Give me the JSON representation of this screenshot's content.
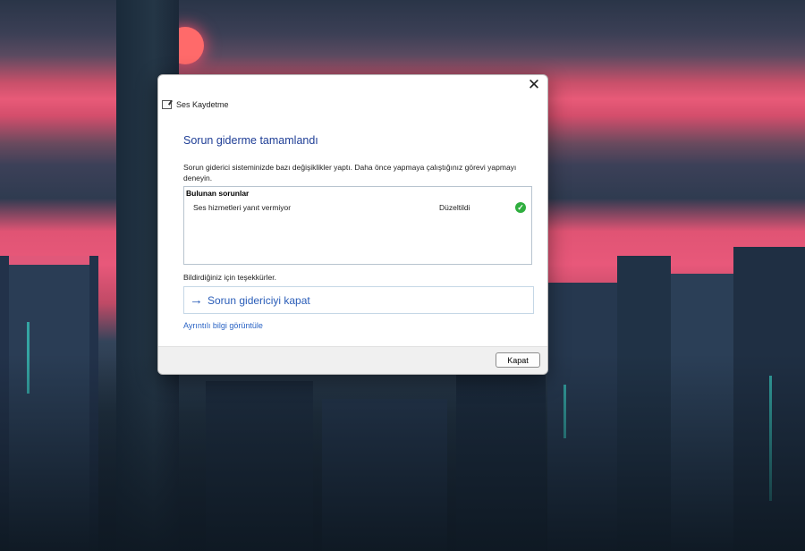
{
  "window": {
    "app_title": "Ses Kaydetme",
    "close_glyph": "✕"
  },
  "content": {
    "heading": "Sorun giderme tamamlandı",
    "description": "Sorun giderici sisteminizde bazı değişiklikler yaptı. Daha önce yapmaya çalıştığınız görevi yapmayı deneyin.",
    "issues_header": "Bulunan sorunlar",
    "issues": [
      {
        "name": "Ses hizmetleri yanıt vermiyor",
        "status": "Düzeltildi",
        "icon": "check-icon"
      }
    ],
    "thanks": "Bildirdiğiniz için teşekkürler.",
    "close_troubleshooter": "Sorun gidericiyi kapat",
    "arrow_glyph": "→",
    "details_link": "Ayrıntılı bilgi görüntüle"
  },
  "footer": {
    "close_button": "Kapat"
  },
  "colors": {
    "heading": "#1f3e96",
    "link": "#2a5db8",
    "success": "#2fae3f"
  }
}
